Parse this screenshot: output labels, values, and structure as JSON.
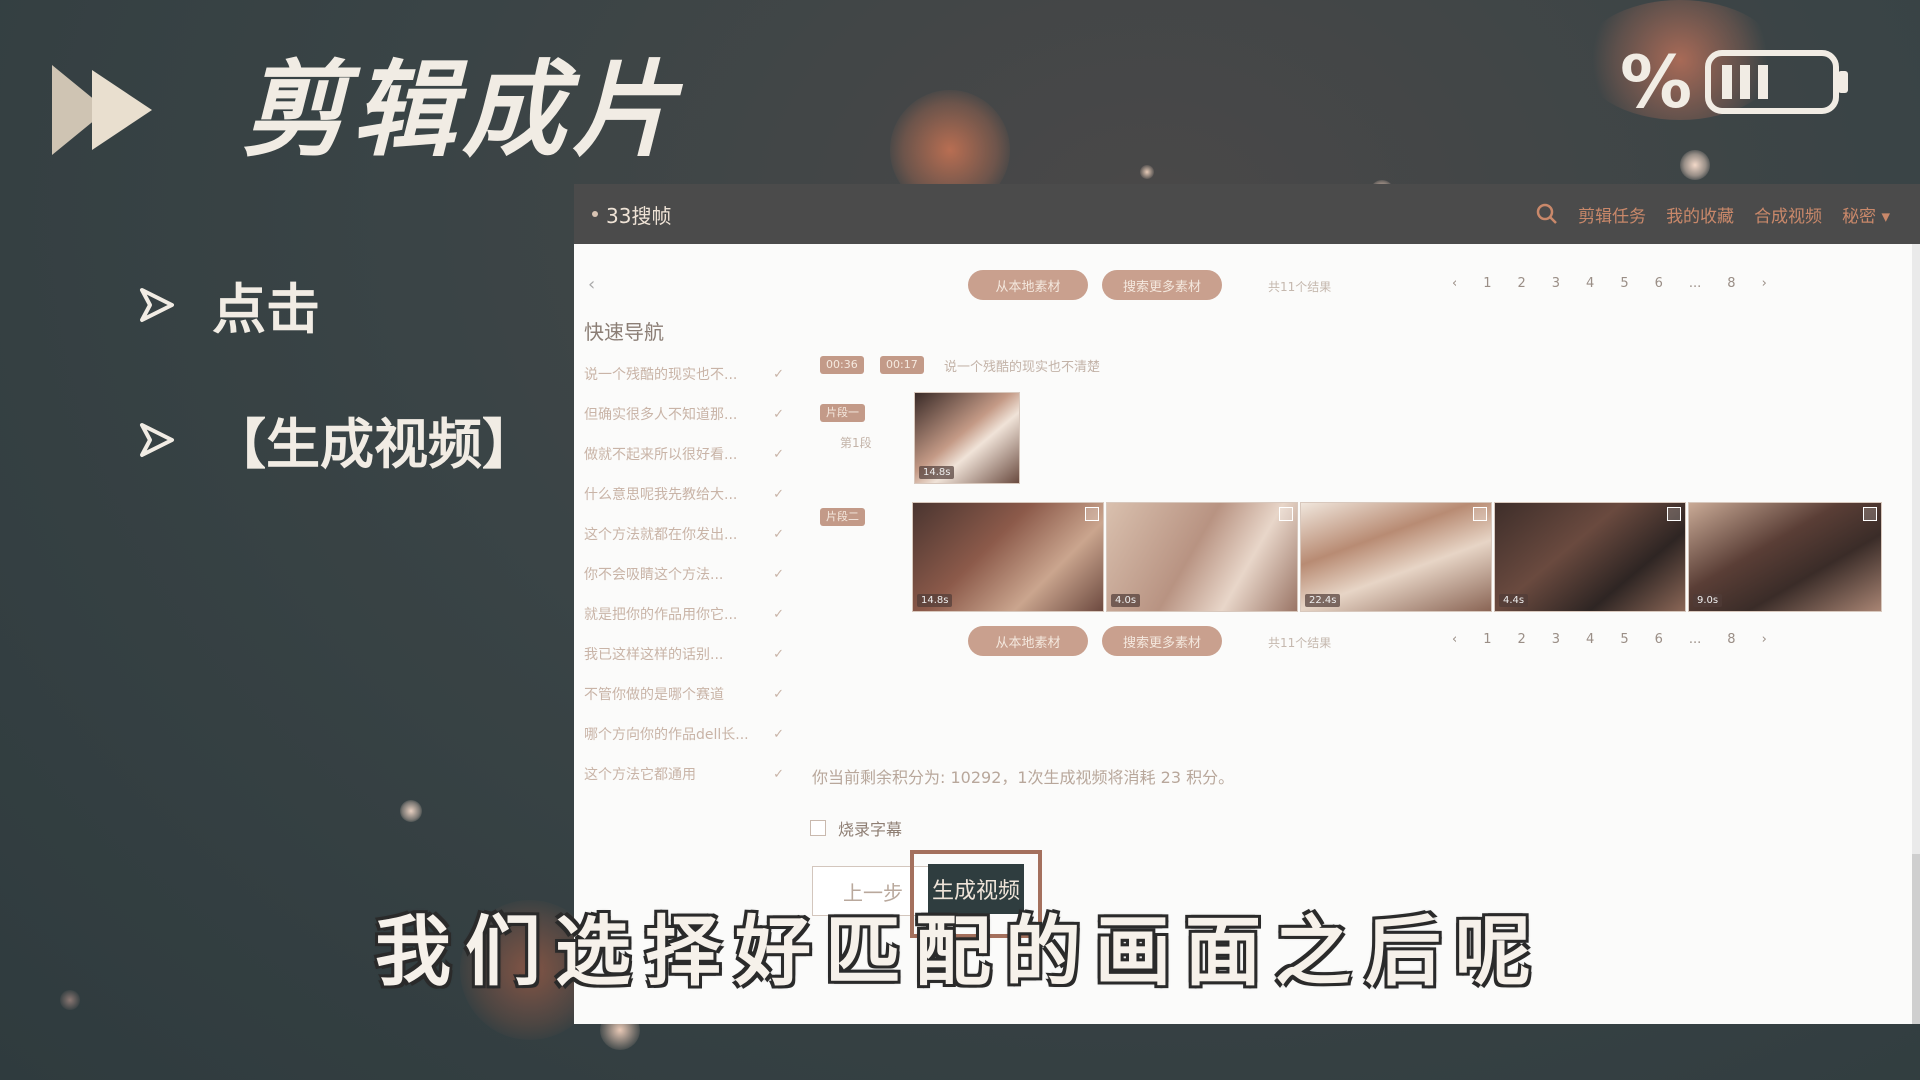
{
  "header": {
    "title": "剪辑成片",
    "battery_label": "%"
  },
  "bullets": [
    {
      "text": "点击"
    },
    {
      "text": "【生成视频】"
    }
  ],
  "app": {
    "brand": "33搜帧",
    "nav": [
      "剪辑任务",
      "我的收藏",
      "合成视频",
      "秘密"
    ],
    "back_label": "‹",
    "quick_nav_title": "快速导航",
    "nav_items": [
      "说一个残酷的现实也不...",
      "但确实很多人不知道那...",
      "做就不起来所以很好看...",
      "什么意思呢我先教给大...",
      "这个方法就都在你发出...",
      "你不会吸睛这个方法...",
      "就是把你的作品用你它...",
      "我已这样这样的话别...",
      "不管你做的是哪个赛道",
      "哪个方向你的作品dell长...",
      "这个方法它都通用"
    ],
    "nav_check": "✓",
    "pill_local": "从本地素材",
    "pill_search": "搜索更多素材",
    "pager_info": "共11个结果",
    "pages": [
      "‹",
      "1",
      "2",
      "3",
      "4",
      "5",
      "6",
      "...",
      "8",
      "›"
    ],
    "tag_time1": "00:36",
    "tag_time2": "00:17",
    "meta_line": "说一个残酷的现实也不清楚",
    "tag_segment1": "片段一",
    "meta_small": "第1段",
    "tag_segment2": "片段二",
    "thumb_badges": [
      "14.8s",
      "14.8s",
      "4.0s",
      "22.4s",
      "4.4s",
      "9.0s"
    ],
    "points_text": "你当前剩余积分为: 10292，1次生成视频将消耗 23 积分。",
    "burn_subtitle_label": "烧录字幕",
    "prev_button": "上一步",
    "generate_button": "生成视频"
  },
  "subtitle": "我们选择好匹配的画面之后呢",
  "colors": {
    "background": "#37434a",
    "accent": "#a4705d",
    "button_dark": "#2f3d3f",
    "text_light": "#f1ece4"
  }
}
